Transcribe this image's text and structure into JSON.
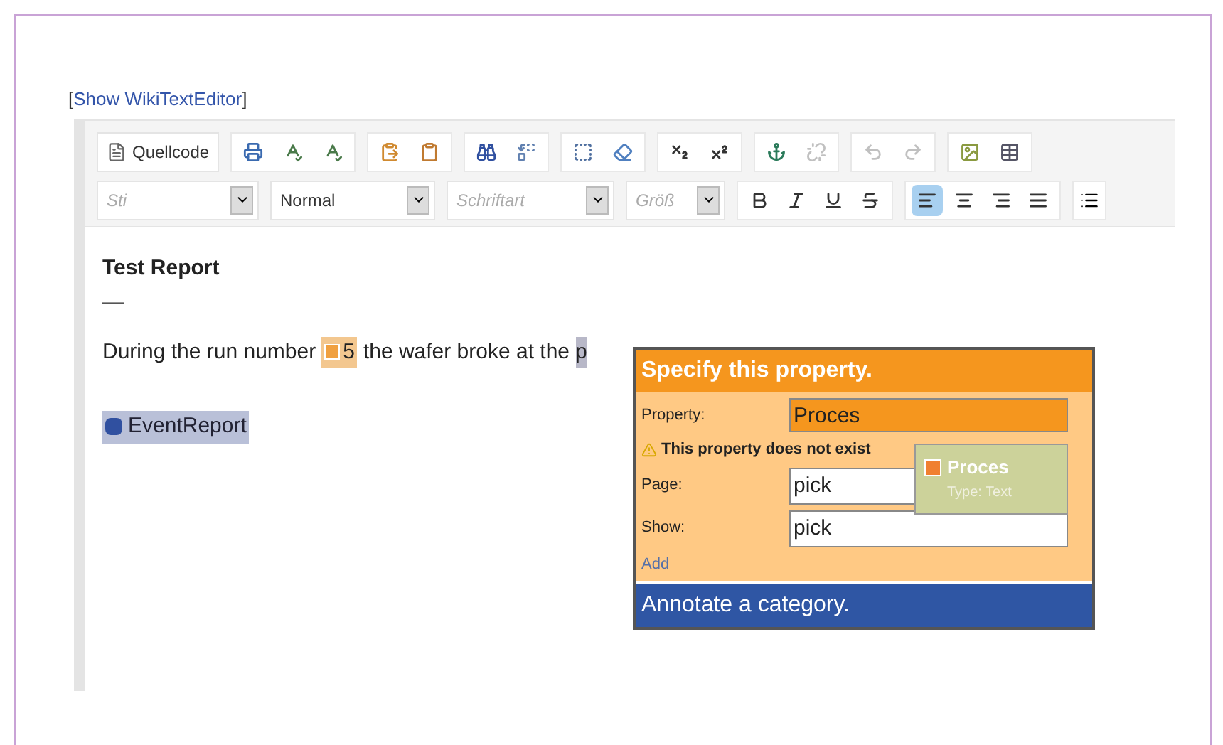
{
  "toggle_link": {
    "open": "[",
    "label": "Show WikiTextEditor",
    "close": "]"
  },
  "toolbar": {
    "source_button": "Quellcode",
    "row1": [
      {
        "kind": "print",
        "disabled": false
      },
      {
        "kind": "spellcheck",
        "disabled": false
      },
      {
        "kind": "spellmenu",
        "disabled": false
      },
      {
        "kind": "paste",
        "disabled": false
      },
      {
        "kind": "pastetext",
        "disabled": false
      },
      {
        "kind": "find",
        "disabled": false
      },
      {
        "kind": "replace",
        "disabled": false
      },
      {
        "kind": "selectall",
        "disabled": false
      },
      {
        "kind": "eraser",
        "disabled": false
      },
      {
        "kind": "subscript",
        "disabled": false
      },
      {
        "kind": "superscript",
        "disabled": false
      },
      {
        "kind": "anchor",
        "disabled": false
      },
      {
        "kind": "unlink",
        "disabled": true
      },
      {
        "kind": "undo",
        "disabled": true
      },
      {
        "kind": "redo",
        "disabled": true
      },
      {
        "kind": "image",
        "disabled": false
      },
      {
        "kind": "table",
        "disabled": false
      }
    ],
    "dropdowns": [
      {
        "placeholder": "Sti"
      },
      {
        "value": "Normal"
      },
      {
        "placeholder": "Schriftart"
      },
      {
        "placeholder": "Größ"
      }
    ],
    "format": [
      {
        "kind": "bold",
        "selected": false
      },
      {
        "kind": "italic",
        "selected": false
      },
      {
        "kind": "underline",
        "selected": false
      },
      {
        "kind": "strike",
        "selected": false
      }
    ],
    "align": [
      {
        "kind": "left",
        "selected": true
      },
      {
        "kind": "center",
        "selected": false
      },
      {
        "kind": "right",
        "selected": false
      },
      {
        "kind": "justify",
        "selected": false
      }
    ]
  },
  "content": {
    "title": "Test Report",
    "rule": "—",
    "sentence": {
      "before": "During the run number",
      "annotation": "5",
      "after": "the wafer broke at the",
      "selected": "p"
    },
    "category": "EventReport"
  },
  "popup": {
    "header": "Specify this property.",
    "property": {
      "label": "Property:",
      "value": "Proces",
      "invalid": true
    },
    "warning": "This property does not exist",
    "fields": [
      {
        "label": "Page:",
        "value": "pick"
      },
      {
        "label": "Show:",
        "value": "pick"
      }
    ],
    "add": "Add",
    "footer": "Annotate a category."
  },
  "suggestion": {
    "name": "Proces",
    "type": "Type: Text"
  }
}
